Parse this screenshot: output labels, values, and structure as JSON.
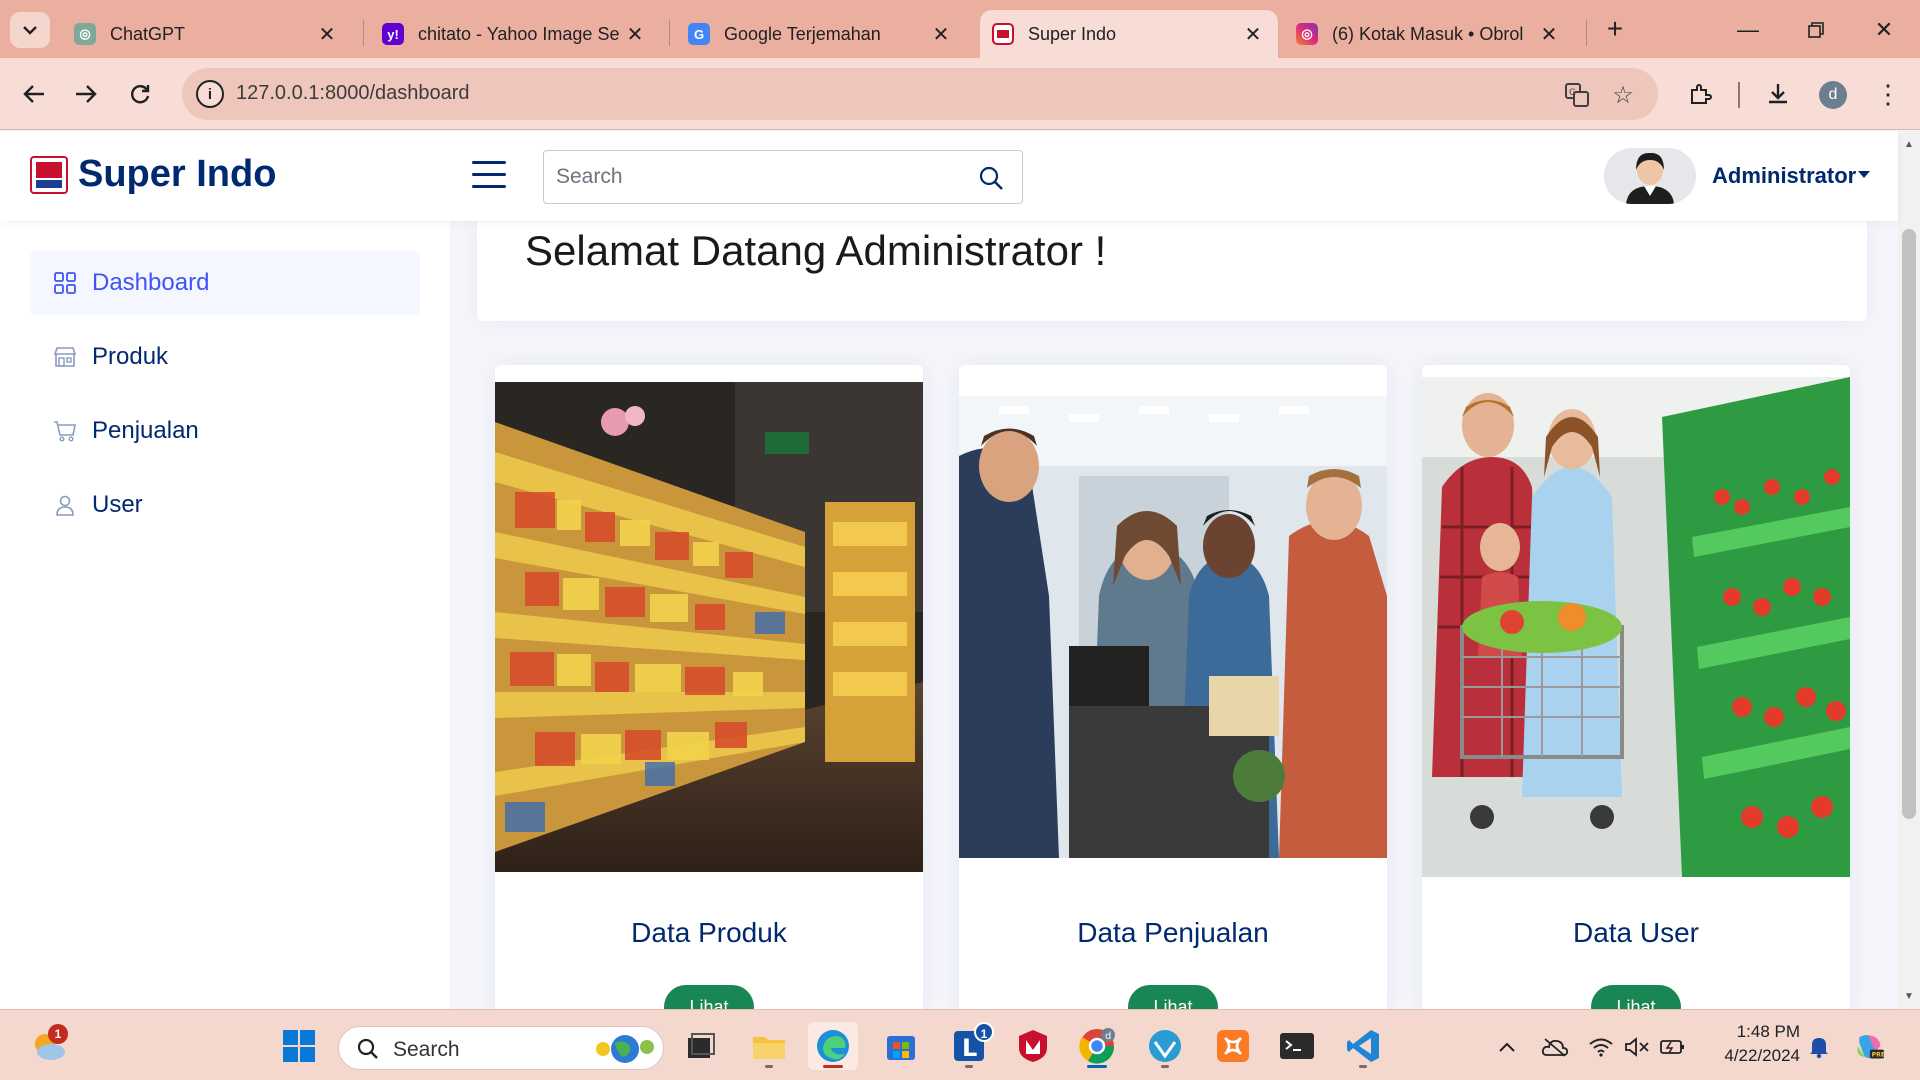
{
  "browser": {
    "tabs": [
      {
        "title": "ChatGPT",
        "favicon": "chatgpt-icon",
        "active": false
      },
      {
        "title": "chitato - Yahoo Image Se",
        "favicon": "yahoo-icon",
        "active": false
      },
      {
        "title": "Google Terjemahan",
        "favicon": "google-translate-icon",
        "active": false
      },
      {
        "title": "Super Indo",
        "favicon": "super-indo-icon",
        "active": true
      },
      {
        "title": "(6) Kotak Masuk • Obrol",
        "favicon": "instagram-icon",
        "active": false
      }
    ],
    "tab_close": "✕",
    "url": "127.0.0.1:8000/dashboard",
    "profile_initial": "d"
  },
  "app": {
    "name": "Super Indo",
    "search_placeholder": "Search",
    "user_name": "Administrator"
  },
  "sidebar": {
    "items": [
      {
        "label": "Dashboard",
        "icon": "grid-icon",
        "active": true
      },
      {
        "label": "Produk",
        "icon": "shop-icon",
        "active": false
      },
      {
        "label": "Penjualan",
        "icon": "cart-icon",
        "active": false
      },
      {
        "label": "User",
        "icon": "person-icon",
        "active": false
      }
    ]
  },
  "main": {
    "welcome": "Selamat Datang Administrator !",
    "cards": [
      {
        "title": "Data Produk",
        "button": "Lihat",
        "image": "supermarket-shelves-image"
      },
      {
        "title": "Data Penjualan",
        "button": "Lihat",
        "image": "checkout-counter-image"
      },
      {
        "title": "Data User",
        "button": "Lihat",
        "image": "family-shopping-image"
      }
    ]
  },
  "taskbar": {
    "search_label": "Search",
    "weather_badge": "1",
    "mail_badge": "1",
    "profile_badge": "d",
    "time": "1:48 PM",
    "date": "4/22/2024"
  },
  "colors": {
    "brand": "#012970",
    "accent": "#4154f1",
    "tab_strip": "#ebaf9f",
    "button": "#198754"
  }
}
